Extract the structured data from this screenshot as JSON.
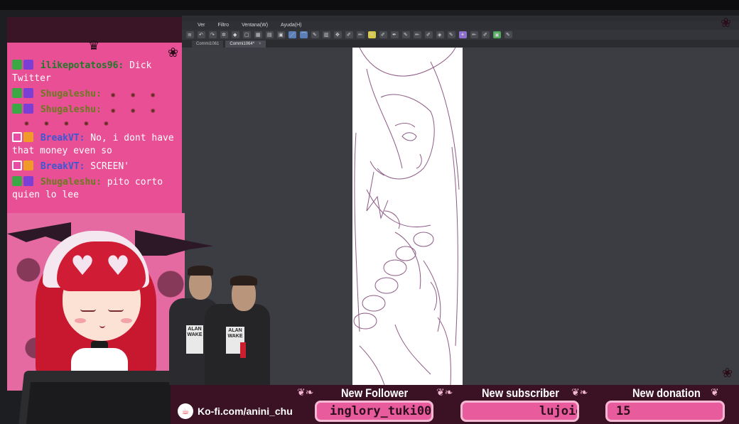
{
  "colors": {
    "chat_bg": "#e84f95",
    "app_bg": "#3c3d42",
    "alert_box": "#e85b9c",
    "bottom_strip": "#3a1223"
  },
  "app": {
    "menu": [
      "Ver",
      "Filtro",
      "Ventana(W)",
      "Ayuda(H)"
    ],
    "tabs": [
      {
        "label": "Commi1061",
        "active": false
      },
      {
        "label": "Commi1064*",
        "active": true
      }
    ]
  },
  "chat": {
    "messages": [
      {
        "user": "ilikepotatos96",
        "text": "Dick Twitter",
        "badges": [
          "sword-badge",
          "gift-badge"
        ]
      },
      {
        "user": "Shugaleshu",
        "text": "",
        "emotes": 3,
        "badges": [
          "sword-badge",
          "gift-badge"
        ]
      },
      {
        "user": "Shugaleshu",
        "text": "",
        "emotes": 3,
        "emote_row": 5,
        "badges": [
          "sword-badge",
          "gift-badge"
        ]
      },
      {
        "user": "BreakVT",
        "text": "No, i dont have that money even so",
        "badges": [
          "heart-badge",
          "bits-badge"
        ]
      },
      {
        "user": "BreakVT",
        "text": "SCREEN'",
        "badges": [
          "heart-badge",
          "bits-badge"
        ]
      },
      {
        "user": "Shugaleshu",
        "text": "pito corto quien lo lee",
        "badges": [
          "sword-badge",
          "gift-badge"
        ]
      }
    ]
  },
  "bottom": {
    "kofi": "Ko-fi.com/anini_chu",
    "alerts": [
      {
        "label": "New Follower",
        "value": "inglory_tuki00"
      },
      {
        "label": "New subscriber",
        "value": "lujoie"
      },
      {
        "label": "New donation",
        "value": "15"
      }
    ]
  },
  "books": {
    "book1": "ALAN WAKE",
    "book2": "ALAN WAKE"
  }
}
